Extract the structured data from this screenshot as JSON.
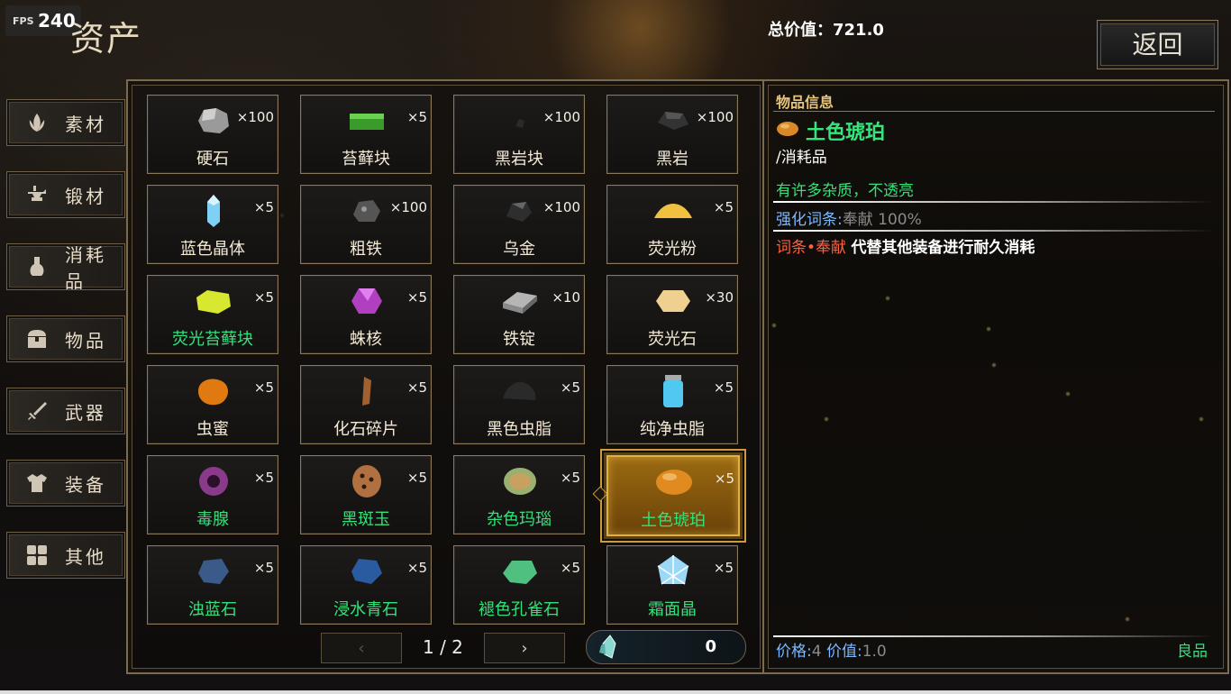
{
  "fps": {
    "label": "FPS",
    "value": "240"
  },
  "page_title": "资产",
  "total_value": "总价值：721.0",
  "back_label": "返回",
  "sidebar": [
    {
      "label": "素材",
      "icon": "leaf-icon"
    },
    {
      "label": "锻材",
      "icon": "anvil-icon"
    },
    {
      "label": "消耗品",
      "icon": "potion-icon"
    },
    {
      "label": "物品",
      "icon": "chest-icon"
    },
    {
      "label": "武器",
      "icon": "sword-icon"
    },
    {
      "label": "装备",
      "icon": "armor-icon"
    },
    {
      "label": "其他",
      "icon": "grid-icon"
    }
  ],
  "items": [
    {
      "name": "硬石",
      "qty": "×100",
      "quality": "white",
      "icon": "stone-icon",
      "color": "#9a9a9a"
    },
    {
      "name": "苔藓块",
      "qty": "×5",
      "quality": "white",
      "icon": "moss-icon",
      "color": "#3a9a2a"
    },
    {
      "name": "黑岩块",
      "qty": "×100",
      "quality": "white",
      "icon": "black-rock-chunk-icon",
      "color": "#2a2a2a"
    },
    {
      "name": "黑岩",
      "qty": "×100",
      "quality": "white",
      "icon": "black-rock-icon",
      "color": "#333333"
    },
    {
      "name": "蓝色晶体",
      "qty": "×5",
      "quality": "white",
      "icon": "blue-crystal-icon",
      "color": "#7ed0f5"
    },
    {
      "name": "粗铁",
      "qty": "×100",
      "quality": "white",
      "icon": "rough-iron-icon",
      "color": "#555555"
    },
    {
      "name": "乌金",
      "qty": "×100",
      "quality": "white",
      "icon": "dark-gold-icon",
      "color": "#2e2e2e"
    },
    {
      "name": "荧光粉",
      "qty": "×5",
      "quality": "white",
      "icon": "glow-powder-icon",
      "color": "#f0c040"
    },
    {
      "name": "荧光苔藓块",
      "qty": "×5",
      "quality": "green",
      "icon": "glow-moss-icon",
      "color": "#d8e830"
    },
    {
      "name": "蛛核",
      "qty": "×5",
      "quality": "white",
      "icon": "spider-core-icon",
      "color": "#b040c0"
    },
    {
      "name": "铁锭",
      "qty": "×10",
      "quality": "white",
      "icon": "iron-ingot-icon",
      "color": "#8a8a8a"
    },
    {
      "name": "荧光石",
      "qty": "×30",
      "quality": "white",
      "icon": "glow-stone-icon",
      "color": "#f0d090"
    },
    {
      "name": "虫蜜",
      "qty": "×5",
      "quality": "white",
      "icon": "bug-honey-icon",
      "color": "#e07a10"
    },
    {
      "name": "化石碎片",
      "qty": "×5",
      "quality": "white",
      "icon": "fossil-fragment-icon",
      "color": "#a06030"
    },
    {
      "name": "黑色虫脂",
      "qty": "×5",
      "quality": "white",
      "icon": "black-resin-icon",
      "color": "#2a2a2a"
    },
    {
      "name": "纯净虫脂",
      "qty": "×5",
      "quality": "white",
      "icon": "pure-resin-jar-icon",
      "color": "#50c8f0"
    },
    {
      "name": "毒腺",
      "qty": "×5",
      "quality": "green",
      "icon": "poison-gland-icon",
      "color": "#8a3a8a"
    },
    {
      "name": "黑斑玉",
      "qty": "×5",
      "quality": "green",
      "icon": "spotted-jade-icon",
      "color": "#b07040"
    },
    {
      "name": "杂色玛瑙",
      "qty": "×5",
      "quality": "green",
      "icon": "agate-icon",
      "color": "#9ab070"
    },
    {
      "name": "土色琥珀",
      "qty": "×5",
      "quality": "green",
      "icon": "amber-icon",
      "color": "#e08a20",
      "selected": true
    },
    {
      "name": "浊蓝石",
      "qty": "×5",
      "quality": "green",
      "icon": "murky-blue-stone-icon",
      "color": "#3a5a8a"
    },
    {
      "name": "浸水青石",
      "qty": "×5",
      "quality": "green",
      "icon": "soaked-bluestone-icon",
      "color": "#2a5aa0"
    },
    {
      "name": "褪色孔雀石",
      "qty": "×5",
      "quality": "green",
      "icon": "malachite-icon",
      "color": "#50c080"
    },
    {
      "name": "霜面晶",
      "qty": "×5",
      "quality": "green",
      "icon": "frost-crystal-icon",
      "color": "#9ad8f8"
    }
  ],
  "pagination": {
    "prev": "‹",
    "next": "›",
    "text": "1 / 2"
  },
  "currency": {
    "value": "0",
    "icon": "crystal-shard-icon"
  },
  "info": {
    "header": "物品信息",
    "name": "土色琥珀",
    "type": "/消耗品",
    "description": "有许多杂质，不透亮",
    "enhance_label": "强化词条:",
    "enhance_value": "奉献 100%",
    "affix_label": "词条•奉献",
    "affix_desc": "代替其他装备进行耐久消耗",
    "price_label": "价格:",
    "price_value": "4",
    "worth_label": "价值:",
    "worth_value": "1.0",
    "quality": "良品"
  },
  "colors": {
    "green_quality": "#35e07a",
    "white_quality": "#f3e9d6",
    "accent_gold": "#e0b040"
  }
}
